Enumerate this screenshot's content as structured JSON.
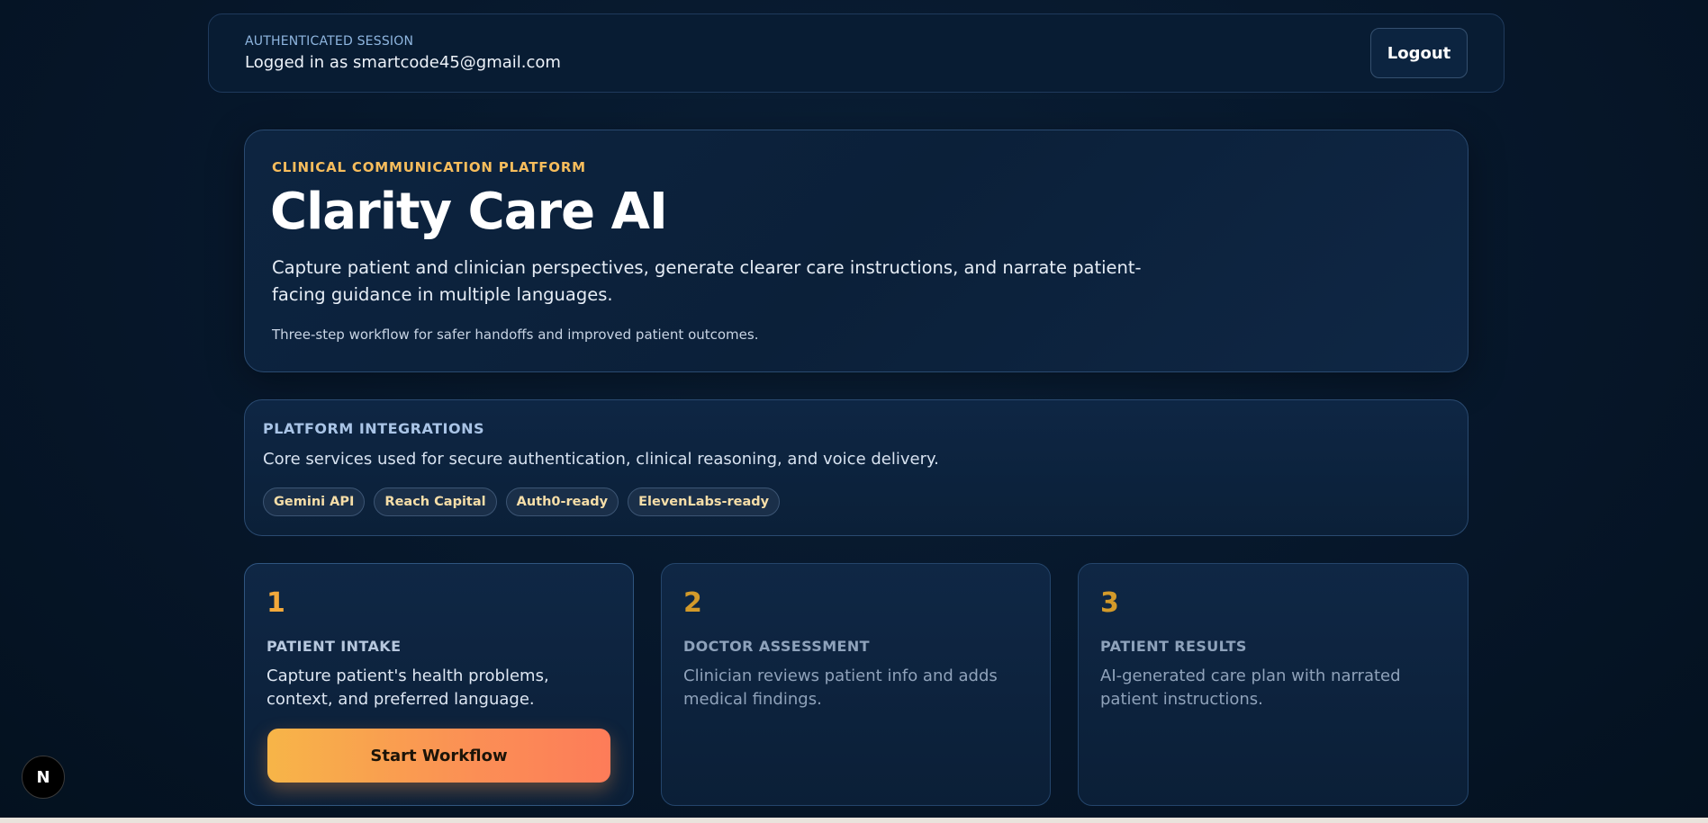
{
  "session": {
    "label": "AUTHENTICATED SESSION",
    "user_text": "Logged in as smartcode45@gmail.com",
    "logout_label": "Logout"
  },
  "hero": {
    "eyebrow": "CLINICAL COMMUNICATION PLATFORM",
    "title": "Clarity Care AI",
    "description": "Capture patient and clinician perspectives, generate clearer care instructions, and narrate patient-facing guidance in multiple languages.",
    "note": "Three-step workflow for safer handoffs and improved patient outcomes."
  },
  "integrations": {
    "title": "PLATFORM INTEGRATIONS",
    "description": "Core services used for secure authentication, clinical reasoning, and voice delivery.",
    "chips": [
      "Gemini API",
      "Reach Capital",
      "Auth0-ready",
      "ElevenLabs-ready"
    ]
  },
  "steps": [
    {
      "number": "1",
      "title": "PATIENT INTAKE",
      "description": "Capture patient's health problems, context, and preferred language.",
      "button_label": "Start Workflow"
    },
    {
      "number": "2",
      "title": "DOCTOR ASSESSMENT",
      "description": "Clinician reviews patient info and adds medical findings."
    },
    {
      "number": "3",
      "title": "PATIENT RESULTS",
      "description": "AI-generated care plan with narrated patient instructions."
    }
  ],
  "dev_badge": "N",
  "colors": {
    "background": "#061629",
    "accent": "#f7bd5c",
    "button_gradient_start": "#f7b548",
    "button_gradient_end": "#fd7c59"
  }
}
